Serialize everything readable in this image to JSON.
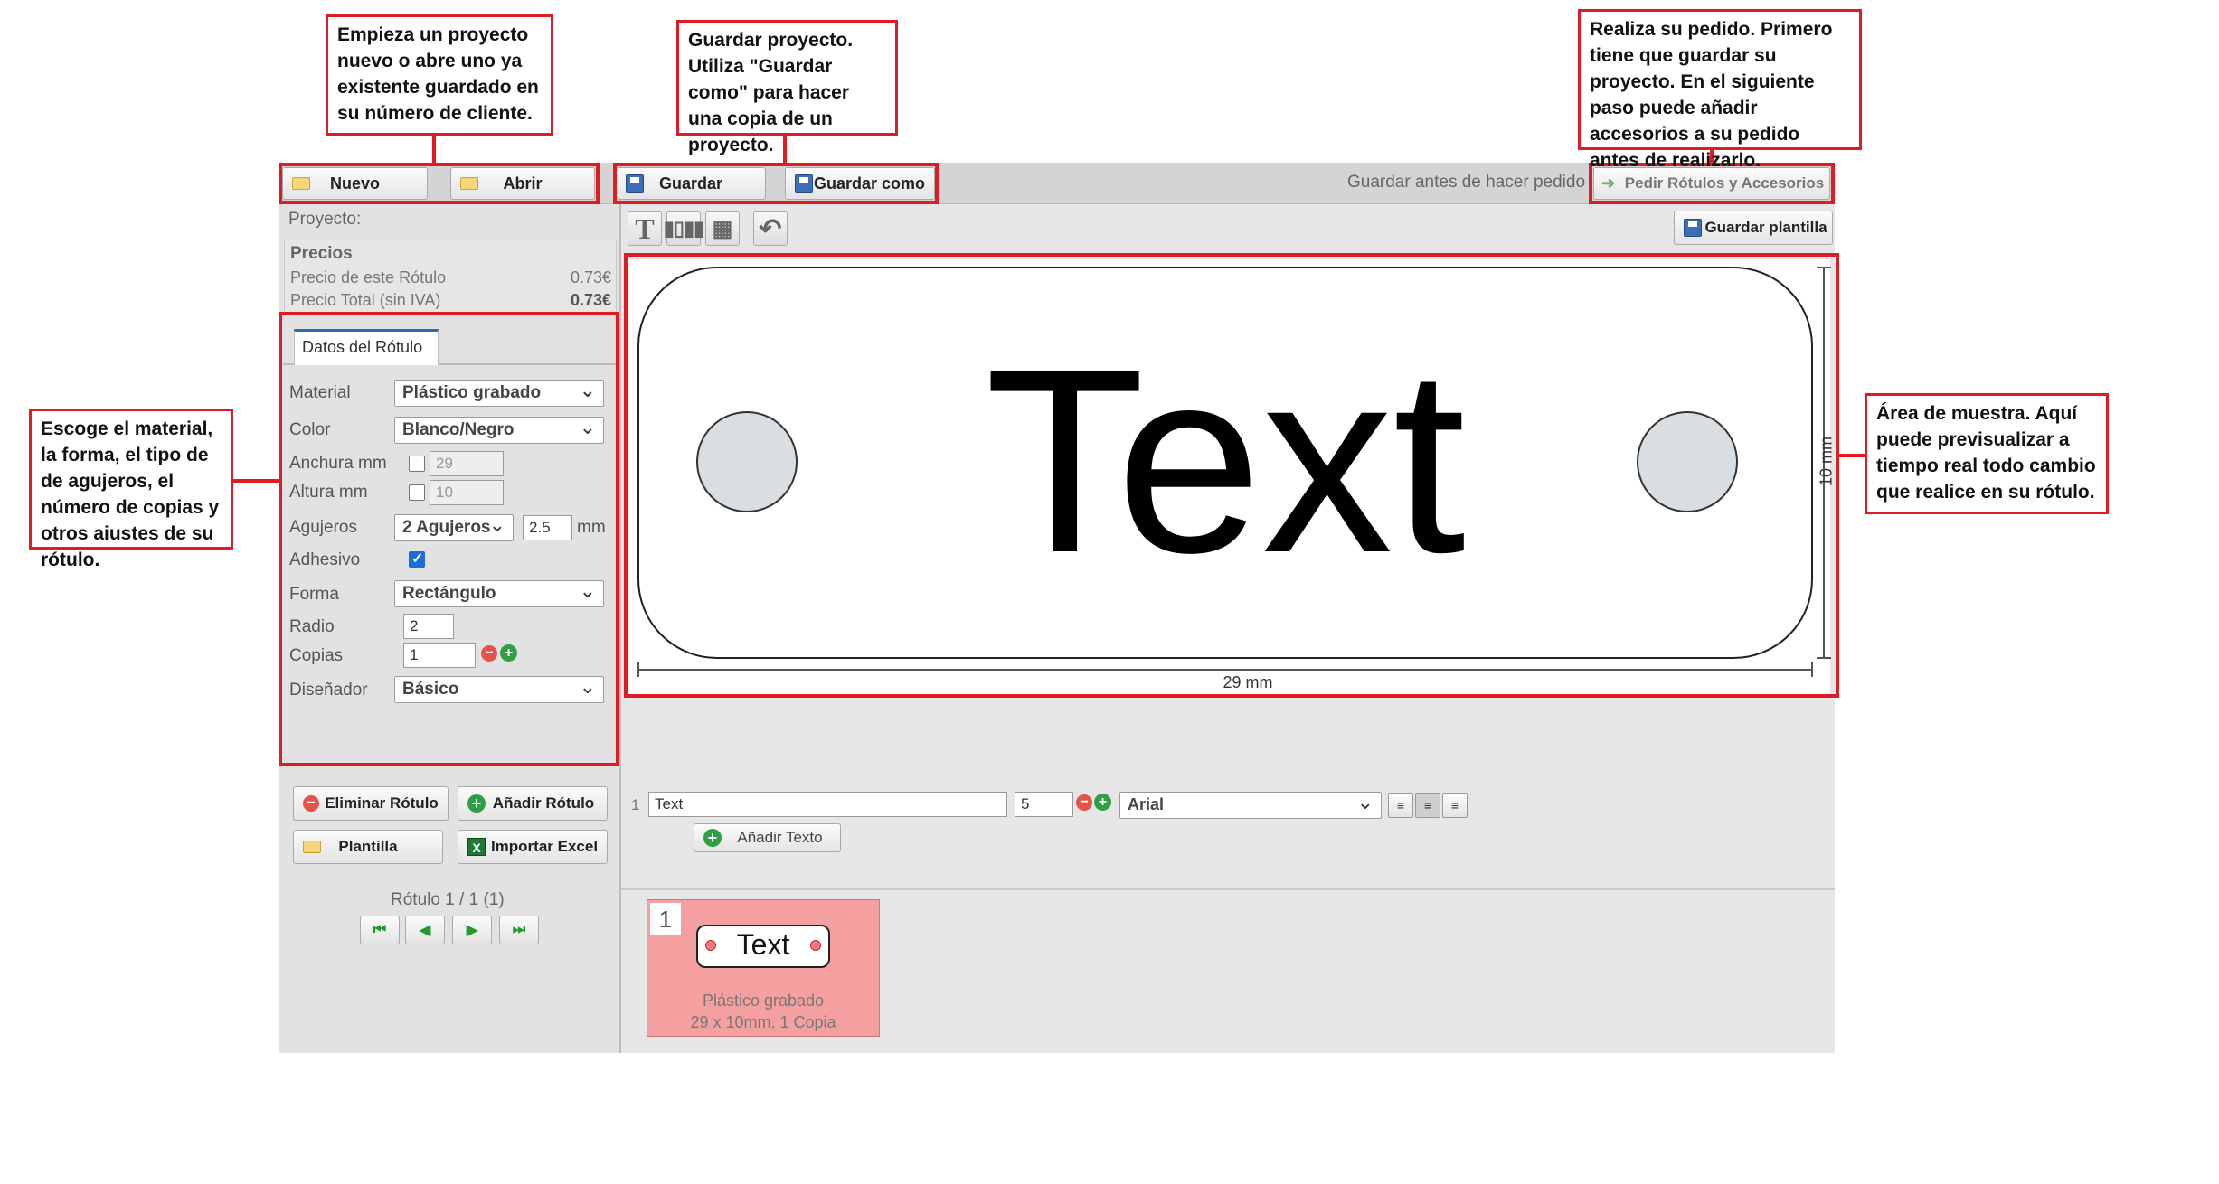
{
  "callouts": {
    "new_open": "Empieza un proyecto nuevo o abre uno ya existente guardado en su número de cliente.",
    "save": "Guardar proyecto. Utiliza \"Guardar como\" para hacer una copia de un proyecto.",
    "order": "Realiza su pedido. Primero tiene que guardar su proyecto. En el siguiente paso puede añadir accesorios a su pedido antes de realizarlo.",
    "settings": "Escoge el material, la forma, el tipo de de agujeros, el número de copias y otros aiustes de su rótulo.",
    "preview": "Área de muestra. Aquí puede previsualizar a tiempo real todo cambio que realice en su rótulo."
  },
  "toolbar": {
    "new_label": "Nuevo",
    "open_label": "Abrir",
    "save_label": "Guardar",
    "save_as_label": "Guardar como",
    "save_hint": "Guardar antes de hacer pedido",
    "order_label": "Pedir Rótulos y Accesorios",
    "save_template_label": "Guardar plantilla"
  },
  "project": {
    "label": "Proyecto:",
    "prices_title": "Precios",
    "price_this_label": "Precio de este Rótulo",
    "price_this_value": "0.73€",
    "price_total_label": "Precio Total (sin IVA)",
    "price_total_value": "0.73€"
  },
  "settings": {
    "tab_label": "Datos del Rótulo",
    "material_label": "Material",
    "material_value": "Plástico grabado",
    "color_label": "Color",
    "color_value": "Blanco/Negro",
    "width_label": "Anchura mm",
    "width_value": "29",
    "height_label": "Altura mm",
    "height_value": "10",
    "holes_label": "Agujeros",
    "holes_value": "2 Agujeros",
    "hole_size_value": "2.5",
    "hole_unit": "mm",
    "adhesive_label": "Adhesivo",
    "shape_label": "Forma",
    "shape_value": "Rectángulo",
    "radius_label": "Radio",
    "radius_value": "2",
    "copies_label": "Copias",
    "copies_value": "1",
    "designer_label": "Diseñador",
    "designer_value": "Básico"
  },
  "actions": {
    "delete_label": "Eliminar Rótulo",
    "add_label": "Añadir Rótulo",
    "template_label": "Plantilla",
    "import_label": "Importar Excel",
    "pagination_text": "Rótulo 1 / 1 (1)"
  },
  "preview": {
    "sign_text": "Text",
    "width_dim": "29 mm",
    "height_dim": "10 mm"
  },
  "text_row": {
    "index": "1",
    "text_value": "Text",
    "size_value": "5",
    "font_value": "Arial",
    "add_text_label": "Añadir Texto"
  },
  "thumbnail": {
    "index": "1",
    "text": "Text",
    "material": "Plástico grabado",
    "details": "29 x 10mm, 1 Copia"
  },
  "colors": {
    "accent_red": "#e01b24",
    "thumbnail_bg": "#f5a0a0"
  }
}
